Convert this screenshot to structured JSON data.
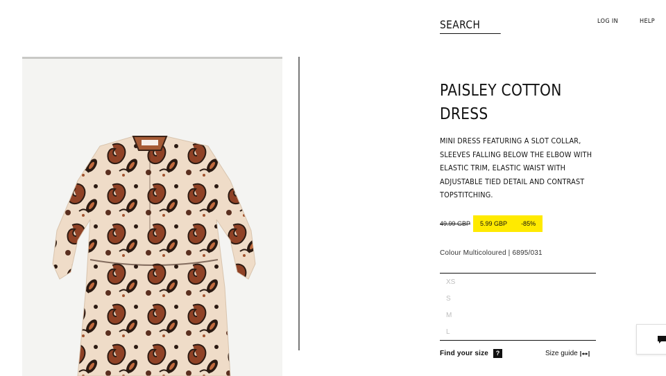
{
  "header": {
    "search_label": "SEARCH",
    "login_label": "LOG IN",
    "help_label": "HELP"
  },
  "product": {
    "title": "PAISLEY COTTON DRESS",
    "description": "MINI DRESS FEATURING A SLOT COLLAR, SLEEVES FALLING BELOW THE ELBOW WITH ELASTIC TRIM, ELASTIC WAIST WITH ADJUSTABLE TIED DETAIL AND CONTRAST TOPSTITCHING.",
    "old_price": "49.99 GBP",
    "sale_price": "5.99 GBP",
    "discount": "-85%",
    "colour_text": "Colour Multicoloured | 6895/031",
    "sizes": [
      "XS",
      "S",
      "M",
      "L"
    ],
    "find_size_label": "Find your size",
    "size_guide_label": "Size guide"
  },
  "icons": {
    "help": "question-icon",
    "size_guide": "resize-arrows-icon",
    "chat": "chat-bubble-icon"
  },
  "colors": {
    "sale_highlight": "#ffea00",
    "dress_base": "#efdcc8",
    "paisley_dark": "#3a2217",
    "paisley_rust": "#9a4a2a"
  }
}
